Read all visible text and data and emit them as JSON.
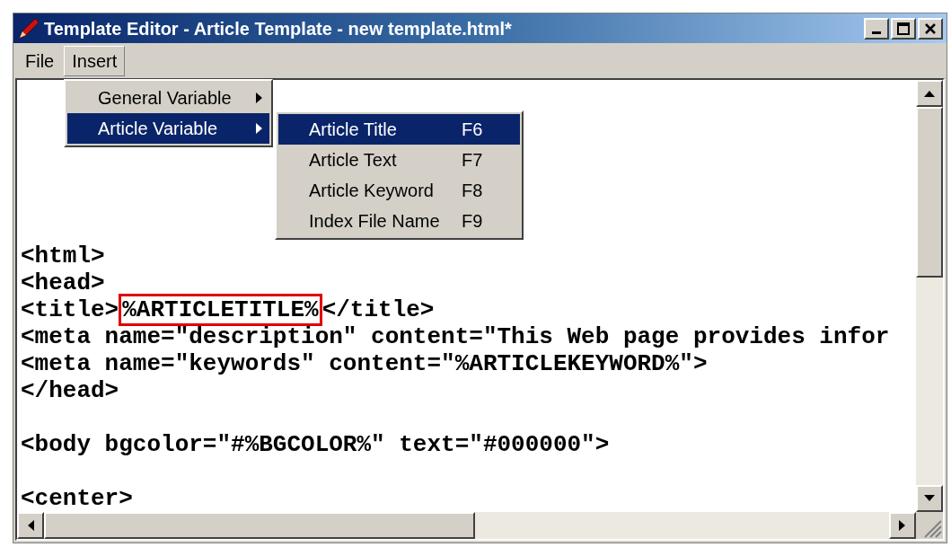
{
  "window": {
    "title": "Template Editor - Article Template - new template.html*"
  },
  "menubar": [
    {
      "label": "File",
      "selected": false
    },
    {
      "label": "Insert",
      "selected": true
    }
  ],
  "insert_menu": [
    {
      "label": "General Variable",
      "selected": false
    },
    {
      "label": "Article Variable",
      "selected": true
    }
  ],
  "article_variable_submenu": [
    {
      "label": "Article Title",
      "shortcut": "F6",
      "selected": true
    },
    {
      "label": "Article Text",
      "shortcut": "F7",
      "selected": false
    },
    {
      "label": "Article Keyword",
      "shortcut": "F8",
      "selected": false
    },
    {
      "label": "Index File Name",
      "shortcut": "F9",
      "selected": false
    }
  ],
  "editor": {
    "lines": [
      {
        "kind": "code",
        "segments": [
          {
            "text": "<html>",
            "highlighted": false
          }
        ]
      },
      {
        "kind": "code",
        "segments": [
          {
            "text": "<head>",
            "highlighted": false
          }
        ]
      },
      {
        "kind": "code",
        "segments": [
          {
            "text": "<title>",
            "highlighted": false
          },
          {
            "text": "%ARTICLETITLE%",
            "highlighted": true
          },
          {
            "text": "</title>",
            "highlighted": false
          }
        ]
      },
      {
        "kind": "code",
        "segments": [
          {
            "text": "<meta name=\"description\" content=\"This Web page provides infor",
            "highlighted": false
          }
        ]
      },
      {
        "kind": "code",
        "segments": [
          {
            "text": "<meta name=\"keywords\" content=\"%ARTICLEKEYWORD%\">",
            "highlighted": false
          }
        ]
      },
      {
        "kind": "code",
        "segments": [
          {
            "text": "</head>",
            "highlighted": false
          }
        ]
      },
      {
        "kind": "blank"
      },
      {
        "kind": "code",
        "segments": [
          {
            "text": "<body bgcolor=\"#%BGCOLOR%\" text=\"#000000\">",
            "highlighted": false
          }
        ]
      },
      {
        "kind": "blank"
      },
      {
        "kind": "code",
        "segments": [
          {
            "text": "<center>",
            "highlighted": false
          }
        ]
      }
    ]
  }
}
